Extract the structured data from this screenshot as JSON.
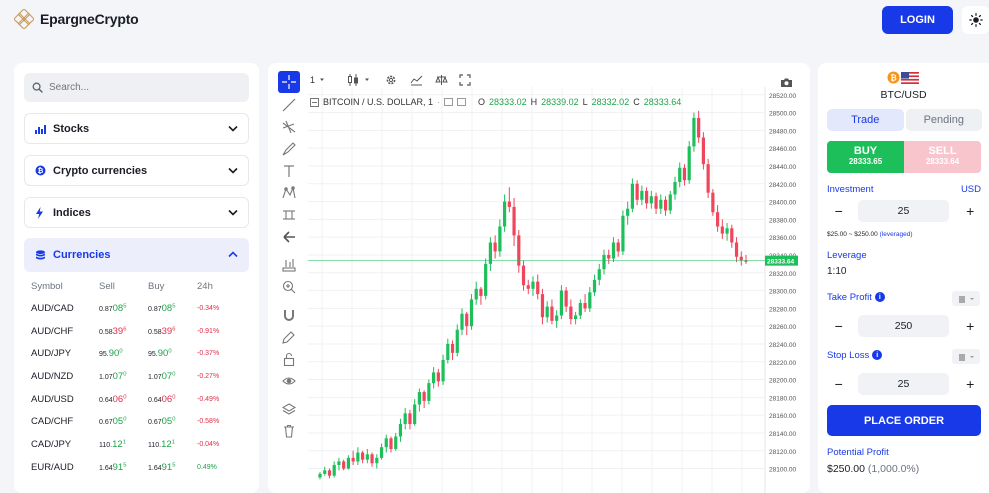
{
  "app": {
    "name": "EpargneCrypto",
    "login_label": "LOGIN"
  },
  "sidebar": {
    "search_placeholder": "Search...",
    "categories": [
      {
        "label": "Stocks",
        "icon": "bar-chart-icon"
      },
      {
        "label": "Crypto currencies",
        "icon": "bitcoin-icon"
      },
      {
        "label": "Indices",
        "icon": "lightning-icon"
      },
      {
        "label": "Currencies",
        "icon": "coins-icon"
      }
    ],
    "table": {
      "headers": [
        "Symbol",
        "Sell",
        "Buy",
        "24h"
      ],
      "rows": [
        {
          "symbol": "AUD/CAD",
          "sell_a": "0.87",
          "sell_b": "08",
          "sell_c": "5",
          "buy_a": "0.87",
          "buy_b": "08",
          "buy_c": "5",
          "change": "-0.34%",
          "dir": "up"
        },
        {
          "symbol": "AUD/CHF",
          "sell_a": "0.58",
          "sell_b": "39",
          "sell_c": "6",
          "buy_a": "0.58",
          "buy_b": "39",
          "buy_c": "6",
          "change": "-0.91%",
          "dir": "dn"
        },
        {
          "symbol": "AUD/JPY",
          "sell_a": "95.",
          "sell_b": "90",
          "sell_c": "0",
          "buy_a": "95.",
          "buy_b": "90",
          "buy_c": "0",
          "change": "-0.37%",
          "dir": "up"
        },
        {
          "symbol": "AUD/NZD",
          "sell_a": "1.07",
          "sell_b": "07",
          "sell_c": "0",
          "buy_a": "1.07",
          "buy_b": "07",
          "buy_c": "0",
          "change": "-0.27%",
          "dir": "up"
        },
        {
          "symbol": "AUD/USD",
          "sell_a": "0.64",
          "sell_b": "06",
          "sell_c": "0",
          "buy_a": "0.64",
          "buy_b": "06",
          "buy_c": "0",
          "change": "-0.49%",
          "dir": "dn"
        },
        {
          "symbol": "CAD/CHF",
          "sell_a": "0.67",
          "sell_b": "05",
          "sell_c": "0",
          "buy_a": "0.67",
          "buy_b": "05",
          "buy_c": "0",
          "change": "-0.58%",
          "dir": "up"
        },
        {
          "symbol": "CAD/JPY",
          "sell_a": "110.",
          "sell_b": "12",
          "sell_c": "1",
          "buy_a": "110.",
          "buy_b": "12",
          "buy_c": "1",
          "change": "-0.04%",
          "dir": "up"
        },
        {
          "symbol": "EUR/AUD",
          "sell_a": "1.64",
          "sell_b": "91",
          "sell_c": "5",
          "buy_a": "1.64",
          "buy_b": "91",
          "buy_c": "5",
          "change": "0.49%",
          "dir": "up"
        }
      ]
    }
  },
  "chart": {
    "interval": "1",
    "symbol_label": "BITCOIN / U.S. DOLLAR, 1",
    "ohlc": {
      "o_label": "O",
      "o": "28333.02",
      "h_label": "H",
      "h": "28339.02",
      "l_label": "L",
      "l": "28332.02",
      "c_label": "C",
      "c": "28333.64"
    },
    "current_price": "28333.64",
    "y_ticks": [
      "28520.00",
      "28500.00",
      "28480.00",
      "28460.00",
      "28440.00",
      "28420.00",
      "28400.00",
      "28380.00",
      "28360.00",
      "28340.00",
      "28320.00",
      "28300.00",
      "28280.00",
      "28260.00",
      "28240.00",
      "28220.00",
      "28200.00",
      "28180.00",
      "28160.00",
      "28140.00",
      "28120.00",
      "28100.00"
    ]
  },
  "chart_data": {
    "type": "candlestick",
    "title": "BITCOIN / U.S. DOLLAR, 1",
    "ylim": [
      28095,
      28522
    ],
    "colors": {
      "up": "#1dbf5b",
      "down": "#f0455a"
    },
    "candles": [
      [
        28090,
        28096,
        28088,
        28094
      ],
      [
        28094,
        28102,
        28092,
        28098
      ],
      [
        28098,
        28100,
        28089,
        28092
      ],
      [
        28092,
        28108,
        28090,
        28104
      ],
      [
        28104,
        28112,
        28098,
        28108
      ],
      [
        28108,
        28110,
        28098,
        28100
      ],
      [
        28100,
        28115,
        28099,
        28112
      ],
      [
        28112,
        28120,
        28104,
        28108
      ],
      [
        28108,
        28124,
        28104,
        28118
      ],
      [
        28118,
        28120,
        28106,
        28110
      ],
      [
        28110,
        28122,
        28106,
        28116
      ],
      [
        28116,
        28118,
        28102,
        28106
      ],
      [
        28106,
        28116,
        28100,
        28112
      ],
      [
        28112,
        28128,
        28110,
        28124
      ],
      [
        28124,
        28138,
        28118,
        28134
      ],
      [
        28134,
        28136,
        28118,
        28122
      ],
      [
        28122,
        28140,
        28120,
        28136
      ],
      [
        28136,
        28156,
        28130,
        28150
      ],
      [
        28150,
        28168,
        28144,
        28162
      ],
      [
        28162,
        28166,
        28144,
        28150
      ],
      [
        28150,
        28178,
        28148,
        28172
      ],
      [
        28172,
        28190,
        28164,
        28186
      ],
      [
        28186,
        28188,
        28168,
        28176
      ],
      [
        28176,
        28200,
        28172,
        28196
      ],
      [
        28196,
        28214,
        28190,
        28208
      ],
      [
        28208,
        28212,
        28192,
        28198
      ],
      [
        28198,
        28228,
        28194,
        28222
      ],
      [
        28222,
        28246,
        28218,
        28240
      ],
      [
        28240,
        28244,
        28222,
        28230
      ],
      [
        28230,
        28262,
        28226,
        28256
      ],
      [
        28256,
        28280,
        28250,
        28274
      ],
      [
        28274,
        28276,
        28250,
        28260
      ],
      [
        28260,
        28296,
        28256,
        28290
      ],
      [
        28290,
        28310,
        28284,
        28302
      ],
      [
        28302,
        28304,
        28284,
        28294
      ],
      [
        28294,
        28336,
        28290,
        28330
      ],
      [
        28330,
        28360,
        28322,
        28354
      ],
      [
        28354,
        28362,
        28336,
        28344
      ],
      [
        28344,
        28380,
        28338,
        28372
      ],
      [
        28372,
        28408,
        28366,
        28400
      ],
      [
        28400,
        28416,
        28388,
        28394
      ],
      [
        28394,
        28404,
        28350,
        28362
      ],
      [
        28362,
        28368,
        28320,
        28328
      ],
      [
        28328,
        28334,
        28300,
        28306
      ],
      [
        28306,
        28312,
        28296,
        28302
      ],
      [
        28302,
        28316,
        28294,
        28310
      ],
      [
        28310,
        28318,
        28290,
        28296
      ],
      [
        28296,
        28302,
        28262,
        28270
      ],
      [
        28270,
        28288,
        28264,
        28282
      ],
      [
        28282,
        28290,
        28262,
        28266
      ],
      [
        28266,
        28278,
        28258,
        28272
      ],
      [
        28272,
        28306,
        28268,
        28300
      ],
      [
        28300,
        28304,
        28276,
        28282
      ],
      [
        28282,
        28290,
        28262,
        28268
      ],
      [
        28268,
        28276,
        28262,
        28272
      ],
      [
        28272,
        28290,
        28268,
        28286
      ],
      [
        28286,
        28296,
        28276,
        28280
      ],
      [
        28280,
        28304,
        28276,
        28298
      ],
      [
        28298,
        28318,
        28294,
        28312
      ],
      [
        28312,
        28330,
        28306,
        28324
      ],
      [
        28324,
        28346,
        28318,
        28340
      ],
      [
        28340,
        28346,
        28330,
        28336
      ],
      [
        28336,
        28360,
        28332,
        28354
      ],
      [
        28354,
        28358,
        28338,
        28344
      ],
      [
        28344,
        28390,
        28340,
        28384
      ],
      [
        28384,
        28400,
        28374,
        28392
      ],
      [
        28392,
        28426,
        28388,
        28420
      ],
      [
        28420,
        28424,
        28396,
        28402
      ],
      [
        28402,
        28418,
        28396,
        28412
      ],
      [
        28412,
        28416,
        28392,
        28398
      ],
      [
        28398,
        28412,
        28392,
        28406
      ],
      [
        28406,
        28410,
        28386,
        28392
      ],
      [
        28392,
        28408,
        28386,
        28402
      ],
      [
        28402,
        28406,
        28384,
        28390
      ],
      [
        28390,
        28412,
        28386,
        28408
      ],
      [
        28408,
        28428,
        28402,
        28422
      ],
      [
        28422,
        28444,
        28416,
        28438
      ],
      [
        28438,
        28442,
        28418,
        28424
      ],
      [
        28424,
        28468,
        28420,
        28462
      ],
      [
        28462,
        28500,
        28456,
        28494
      ],
      [
        28494,
        28502,
        28466,
        28472
      ],
      [
        28472,
        28478,
        28436,
        28442
      ],
      [
        28442,
        28448,
        28404,
        28410
      ],
      [
        28410,
        28414,
        28384,
        28388
      ],
      [
        28388,
        28396,
        28366,
        28372
      ],
      [
        28372,
        28380,
        28358,
        28364
      ],
      [
        28364,
        28376,
        28356,
        28370
      ],
      [
        28370,
        28374,
        28348,
        28354
      ],
      [
        28354,
        28360,
        28332,
        28338
      ],
      [
        28338,
        28344,
        28328,
        28334
      ],
      [
        28334,
        28340,
        28330,
        28333.64
      ]
    ]
  },
  "trade": {
    "pair": "BTC/USD",
    "tab_trade": "Trade",
    "tab_pending": "Pending",
    "buy_label": "BUY",
    "buy_price": "28333.65",
    "sell_label": "SELL",
    "sell_price": "28333.64",
    "investment_label": "Investment",
    "currency": "USD",
    "investment": "25",
    "range_note": "$25.00 ~ $250.00",
    "leveraged_note": "(leveraged)",
    "leverage_label": "Leverage",
    "leverage": "1:10",
    "take_profit_label": "Take Profit",
    "take_profit": "250",
    "stop_loss_label": "Stop Loss",
    "stop_loss": "25",
    "place_order": "PLACE ORDER",
    "potential_profit_label": "Potential Profit",
    "potential_profit": "$250.00",
    "potential_profit_pct": "(1,000.0%)"
  }
}
